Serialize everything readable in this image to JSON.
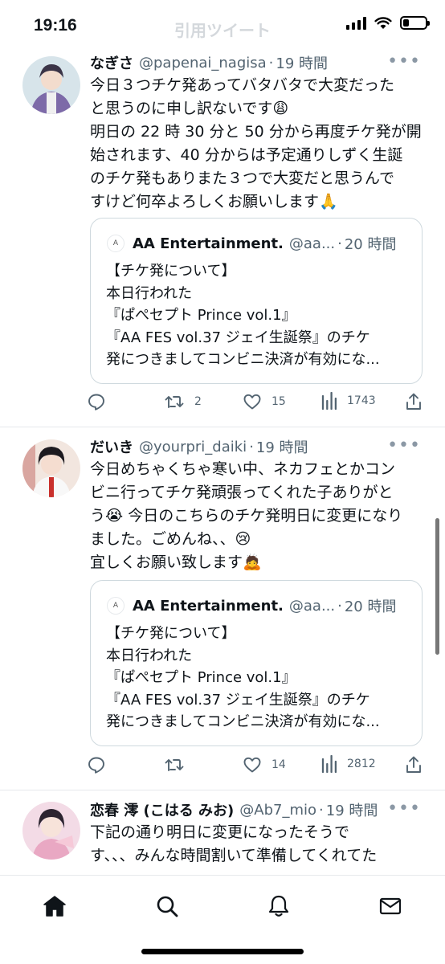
{
  "status_bar": {
    "time": "19:16",
    "faded_title": "引用ツイート",
    "battery_level": 0.25
  },
  "tweets": [
    {
      "name": "なぎさ",
      "handle": "@papenai_nagisa",
      "dot": "·",
      "time": "19 時間",
      "more": "•••",
      "lines": [
        "今日３つチケ発あってバタバタで大変だった",
        "と思うのに申し訳ないです😩",
        "明日の 22 時 30 分と 50 分から再度チケ発が開",
        "始されます、40 分からは予定通りしずく生誕",
        "のチケ発もありまた３つで大変だと思うんで",
        "すけど何卒よろしくお願いします🙏"
      ],
      "quote": {
        "name": "AA Entertainment.",
        "handle": "@aa...",
        "dot": "·",
        "time": "20 時間",
        "lines": [
          "【チケ発について】",
          "本日行われた",
          "『ぱぺセプト Prince vol.1』",
          "『AA FES vol.37 ジェイ生誕祭』のチケ",
          "発につきましてコンビニ決済が有効にな..."
        ]
      },
      "stats": {
        "retweets": "2",
        "likes": "15",
        "views": "1743"
      }
    },
    {
      "name": "だいき",
      "handle": "@yourpri_daiki",
      "dot": "·",
      "time": "19 時間",
      "more": "•••",
      "lines": [
        "今日めちゃくちゃ寒い中、ネカフェとかコン",
        "ビニ行ってチケ発頑張ってくれた子ありがと",
        "う😭 今日のこちらのチケ発明日に変更になり",
        "ました。ごめんね、、😢",
        "宜しくお願い致します🙇"
      ],
      "quote": {
        "name": "AA Entertainment.",
        "handle": "@aa...",
        "dot": "·",
        "time": "20 時間",
        "lines": [
          "【チケ発について】",
          "本日行われた",
          "『ぱぺセプト Prince vol.1』",
          "『AA FES vol.37 ジェイ生誕祭』のチケ",
          "発につきましてコンビニ決済が有効にな..."
        ]
      },
      "stats": {
        "retweets": "",
        "likes": "14",
        "views": "2812"
      }
    },
    {
      "name": "恋春 澪 (こはる みお)",
      "handle": "@Ab7_mio",
      "dot": "·",
      "time": "19 時間",
      "more": "•••",
      "lines": [
        "下記の通り明日に変更になったそうで",
        "す、、、みんな時間割いて準備してくれてた"
      ]
    }
  ],
  "icons": {
    "reply": "reply-icon",
    "retweet": "retweet-icon",
    "like": "heart-icon",
    "views": "views-icon",
    "share": "share-icon",
    "nav": [
      "home-icon",
      "search-icon",
      "bell-icon",
      "mail-icon"
    ]
  }
}
